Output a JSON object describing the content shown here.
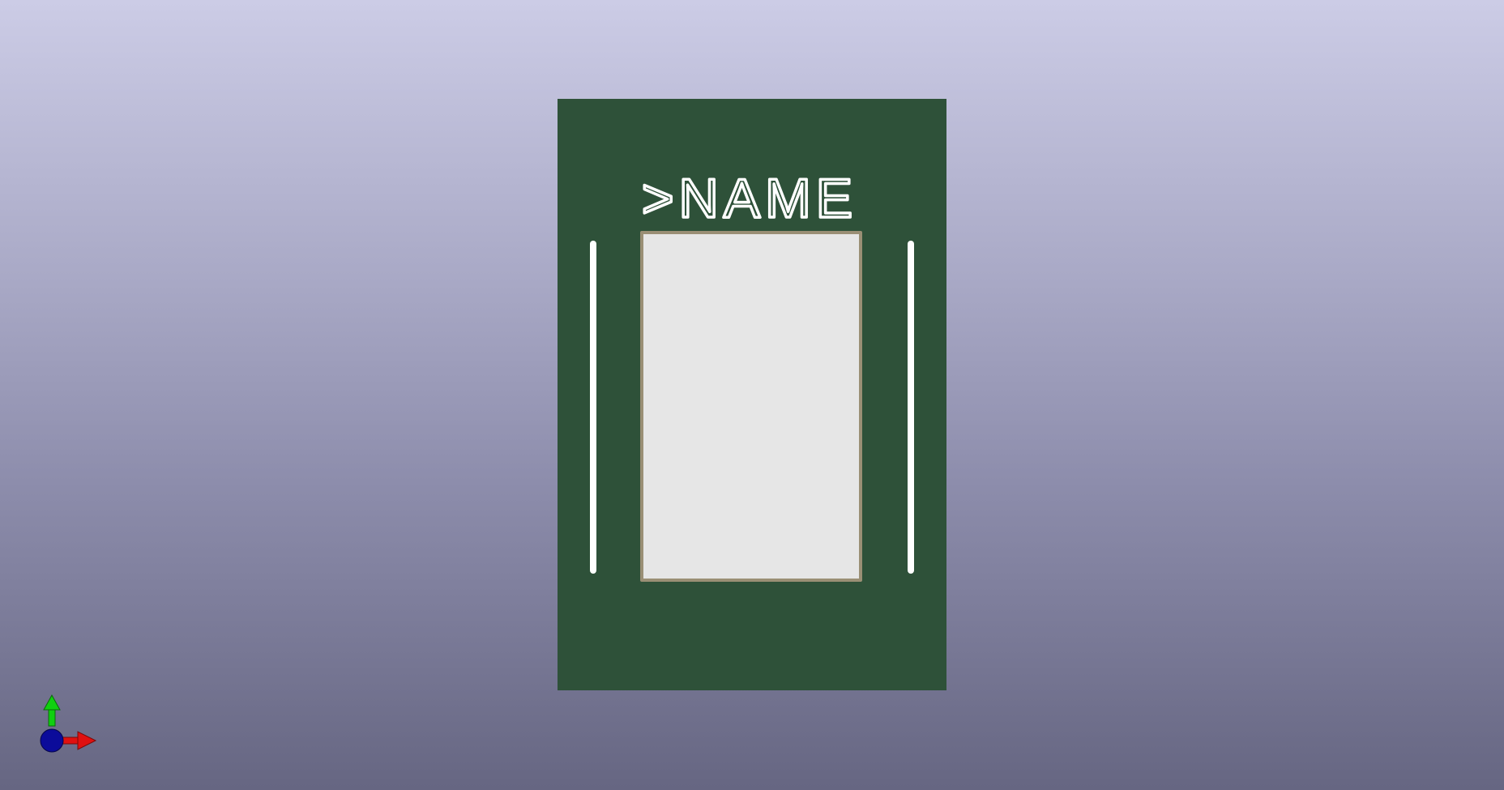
{
  "viewer": {
    "board_color": "#2e5139",
    "silkscreen_color": "#ffffff",
    "pad_color": "#e6e6e6",
    "pad_outline_color": "#9a8f75",
    "reference_text": ">NAME"
  },
  "axis_gizmo": {
    "x_color": "#e01010",
    "y_color": "#10d010",
    "z_color": "#0b0b9a"
  }
}
